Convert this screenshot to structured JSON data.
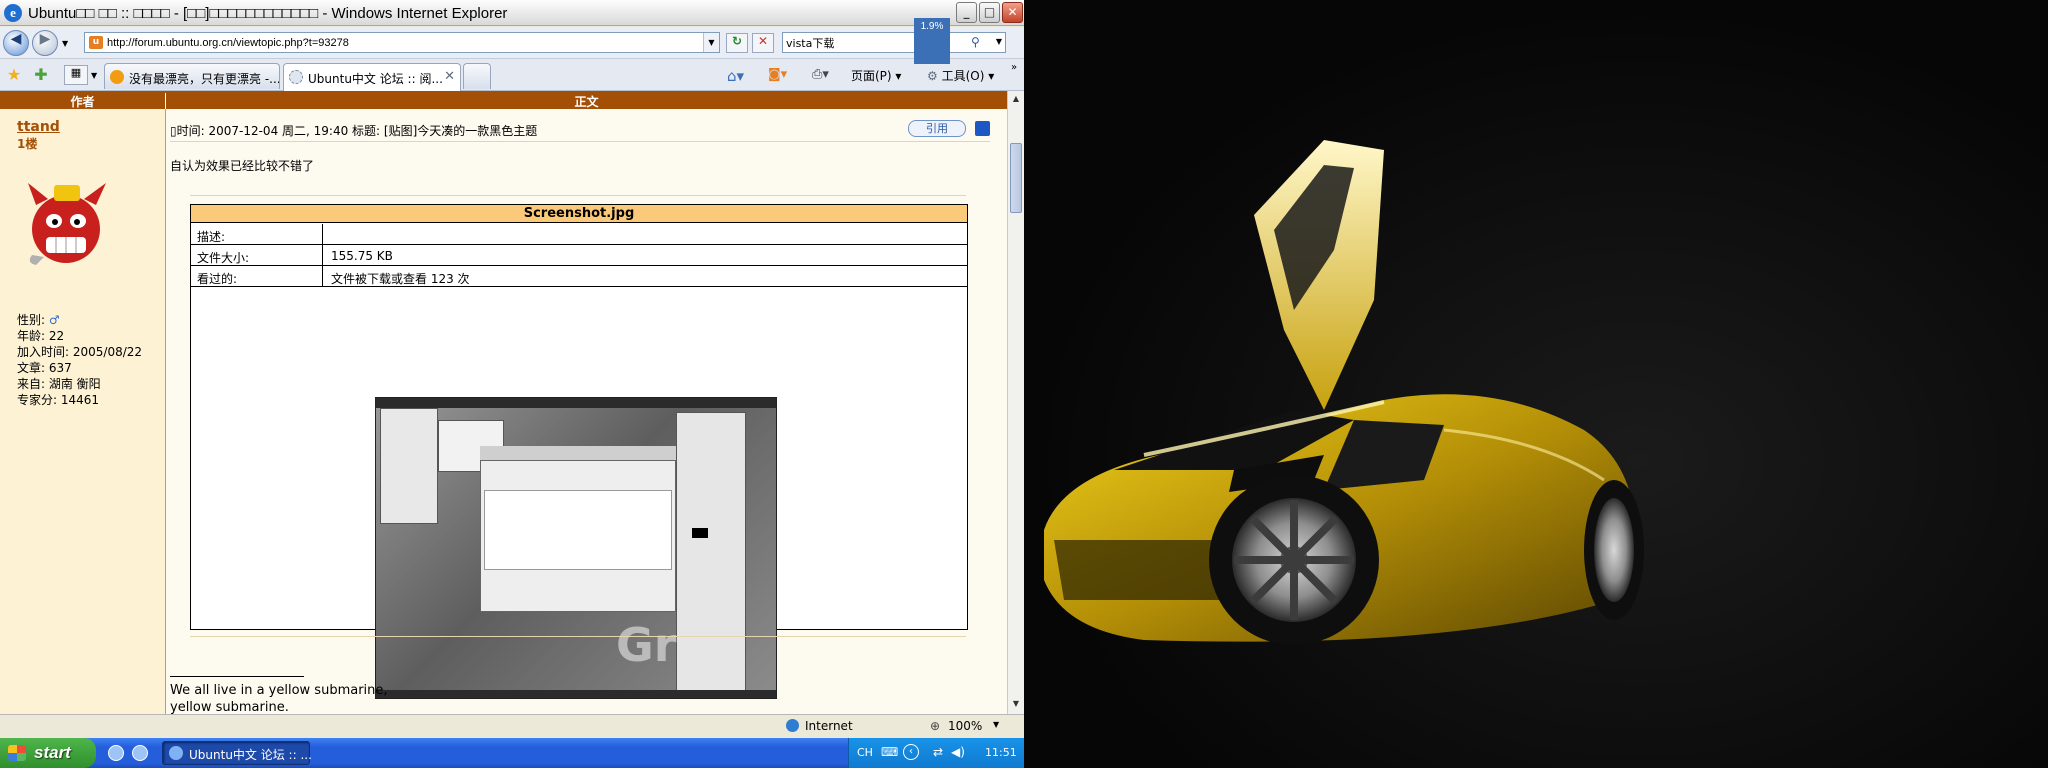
{
  "window": {
    "title": "Ubuntu□□ □□ :: □□□□ - [□□]□□□□□□□□□□□□ - Windows Internet Explorer",
    "controls": {
      "minimize": "_",
      "maximize": "□",
      "close": "✕"
    }
  },
  "address_bar": {
    "url": "http://forum.ubuntu.org.cn/viewtopic.php?t=93278",
    "search_value": "vista下载",
    "progress_badge": "1.9%"
  },
  "tabs": [
    {
      "label": "没有最漂亮，只有更漂亮 -...",
      "active": false
    },
    {
      "label": "Ubuntu中文 论坛 :: 阅...",
      "active": true
    }
  ],
  "toolbar": {
    "page_label": "页面(P)",
    "tools_label": "工具(O)"
  },
  "table_header": {
    "author": "作者",
    "body": "正文"
  },
  "post": {
    "username": "ttand",
    "floor": "1楼",
    "profile": {
      "gender_label": "性别:",
      "age": "年龄: 22",
      "joined": "加入时间: 2005/08/22",
      "posts": "文章: 637",
      "from": "来自: 湖南 衡阳",
      "expert_points": "专家分: 14461"
    },
    "meta": "时间: 2007-12-04 周二, 19:40    标题: [贴图]今天凑的一款黑色主题",
    "quote_label": "引用",
    "text": "自认为效果已经比较不错了",
    "attachment": {
      "filename": "Screenshot.jpg",
      "rows": [
        {
          "key": "描述:",
          "value": ""
        },
        {
          "key": "文件大小:",
          "value": "155.75 KB"
        },
        {
          "key": "看过的:",
          "value": "文件被下载或查看  123 次"
        }
      ]
    },
    "signature": [
      "We all live in a yellow submarine,",
      "yellow submarine."
    ]
  },
  "statusbar": {
    "zone": "Internet",
    "zoom": "100%"
  },
  "taskbar": {
    "start_label": "start",
    "task_label": "Ubuntu中文 论坛 :: ...",
    "lang": "CH",
    "clock": "11:51"
  }
}
